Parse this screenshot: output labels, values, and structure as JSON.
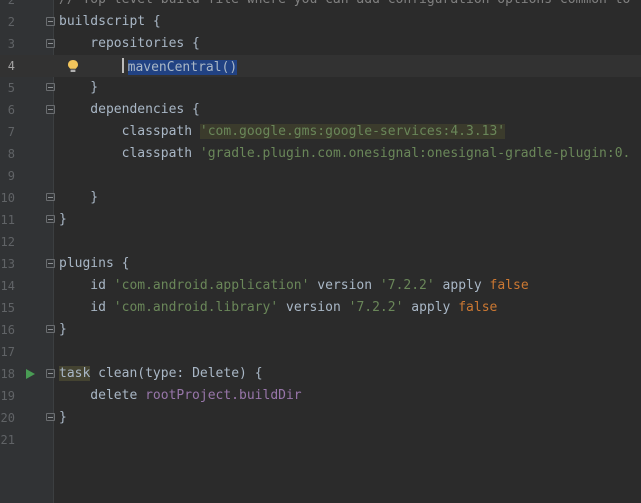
{
  "editor": {
    "lines": [
      {
        "num": "2",
        "segments": [
          {
            "t": "// Top-level build file where you can add configuration options common to",
            "c": "comment"
          }
        ]
      },
      {
        "num": "2",
        "segments": [
          {
            "t": "buildscript {",
            "c": "plain"
          }
        ]
      },
      {
        "num": "3",
        "segments": [
          {
            "t": "    repositories {",
            "c": "plain"
          }
        ]
      },
      {
        "num": "4",
        "segments": [
          {
            "t": "mavenCentral()",
            "c": "hl-ident"
          }
        ]
      },
      {
        "num": "5",
        "segments": [
          {
            "t": "    }",
            "c": "plain"
          }
        ]
      },
      {
        "num": "6",
        "segments": [
          {
            "t": "    dependencies {",
            "c": "plain"
          }
        ]
      },
      {
        "num": "7",
        "segments": [
          {
            "t": "        classpath ",
            "c": "plain"
          },
          {
            "t": "'com.google.gms:google-services:4.3.13'",
            "c": "str-warn"
          }
        ]
      },
      {
        "num": "8",
        "segments": [
          {
            "t": "        classpath ",
            "c": "plain"
          },
          {
            "t": "'gradle.plugin.com.onesignal:onesignal-gradle-plugin:0.",
            "c": "str"
          }
        ]
      },
      {
        "num": "9",
        "segments": []
      },
      {
        "num": "10",
        "segments": [
          {
            "t": "    }",
            "c": "plain"
          }
        ]
      },
      {
        "num": "11",
        "segments": [
          {
            "t": "}",
            "c": "plain"
          }
        ]
      },
      {
        "num": "12",
        "segments": []
      },
      {
        "num": "13",
        "segments": [
          {
            "t": "plugins {",
            "c": "plain"
          }
        ]
      },
      {
        "num": "14",
        "segments": [
          {
            "t": "    id ",
            "c": "plain"
          },
          {
            "t": "'com.android.application'",
            "c": "str"
          },
          {
            "t": " version ",
            "c": "plain"
          },
          {
            "t": "'7.2.2'",
            "c": "str"
          },
          {
            "t": " apply ",
            "c": "plain"
          },
          {
            "t": "false",
            "c": "kw"
          }
        ]
      },
      {
        "num": "15",
        "segments": [
          {
            "t": "    id ",
            "c": "plain"
          },
          {
            "t": "'com.android.library'",
            "c": "str"
          },
          {
            "t": " version ",
            "c": "plain"
          },
          {
            "t": "'7.2.2'",
            "c": "str"
          },
          {
            "t": " apply ",
            "c": "plain"
          },
          {
            "t": "false",
            "c": "kw"
          }
        ]
      },
      {
        "num": "16",
        "segments": [
          {
            "t": "}",
            "c": "plain"
          }
        ]
      },
      {
        "num": "17",
        "segments": []
      },
      {
        "num": "18",
        "segments": [
          {
            "t": "task",
            "c": "task-hl"
          },
          {
            "t": " clean(",
            "c": "plain"
          },
          {
            "t": "type",
            "c": "named"
          },
          {
            "t": ": Delete) {",
            "c": "plain"
          }
        ]
      },
      {
        "num": "19",
        "segments": [
          {
            "t": "    delete ",
            "c": "plain"
          },
          {
            "t": "rootProject.buildDir",
            "c": "prop"
          }
        ]
      },
      {
        "num": "20",
        "segments": [
          {
            "t": "}",
            "c": "plain"
          }
        ]
      },
      {
        "num": "21",
        "segments": []
      }
    ]
  },
  "colors": {
    "background": "#2b2b2b",
    "gutter": "#313335",
    "string": "#6a8759",
    "keyword": "#cc7832",
    "property": "#9876aa",
    "selection": "#214283"
  },
  "icons": {
    "intention": "lightbulb-icon",
    "run": "run-gutter-icon",
    "fold": "fold-marker-icon"
  }
}
